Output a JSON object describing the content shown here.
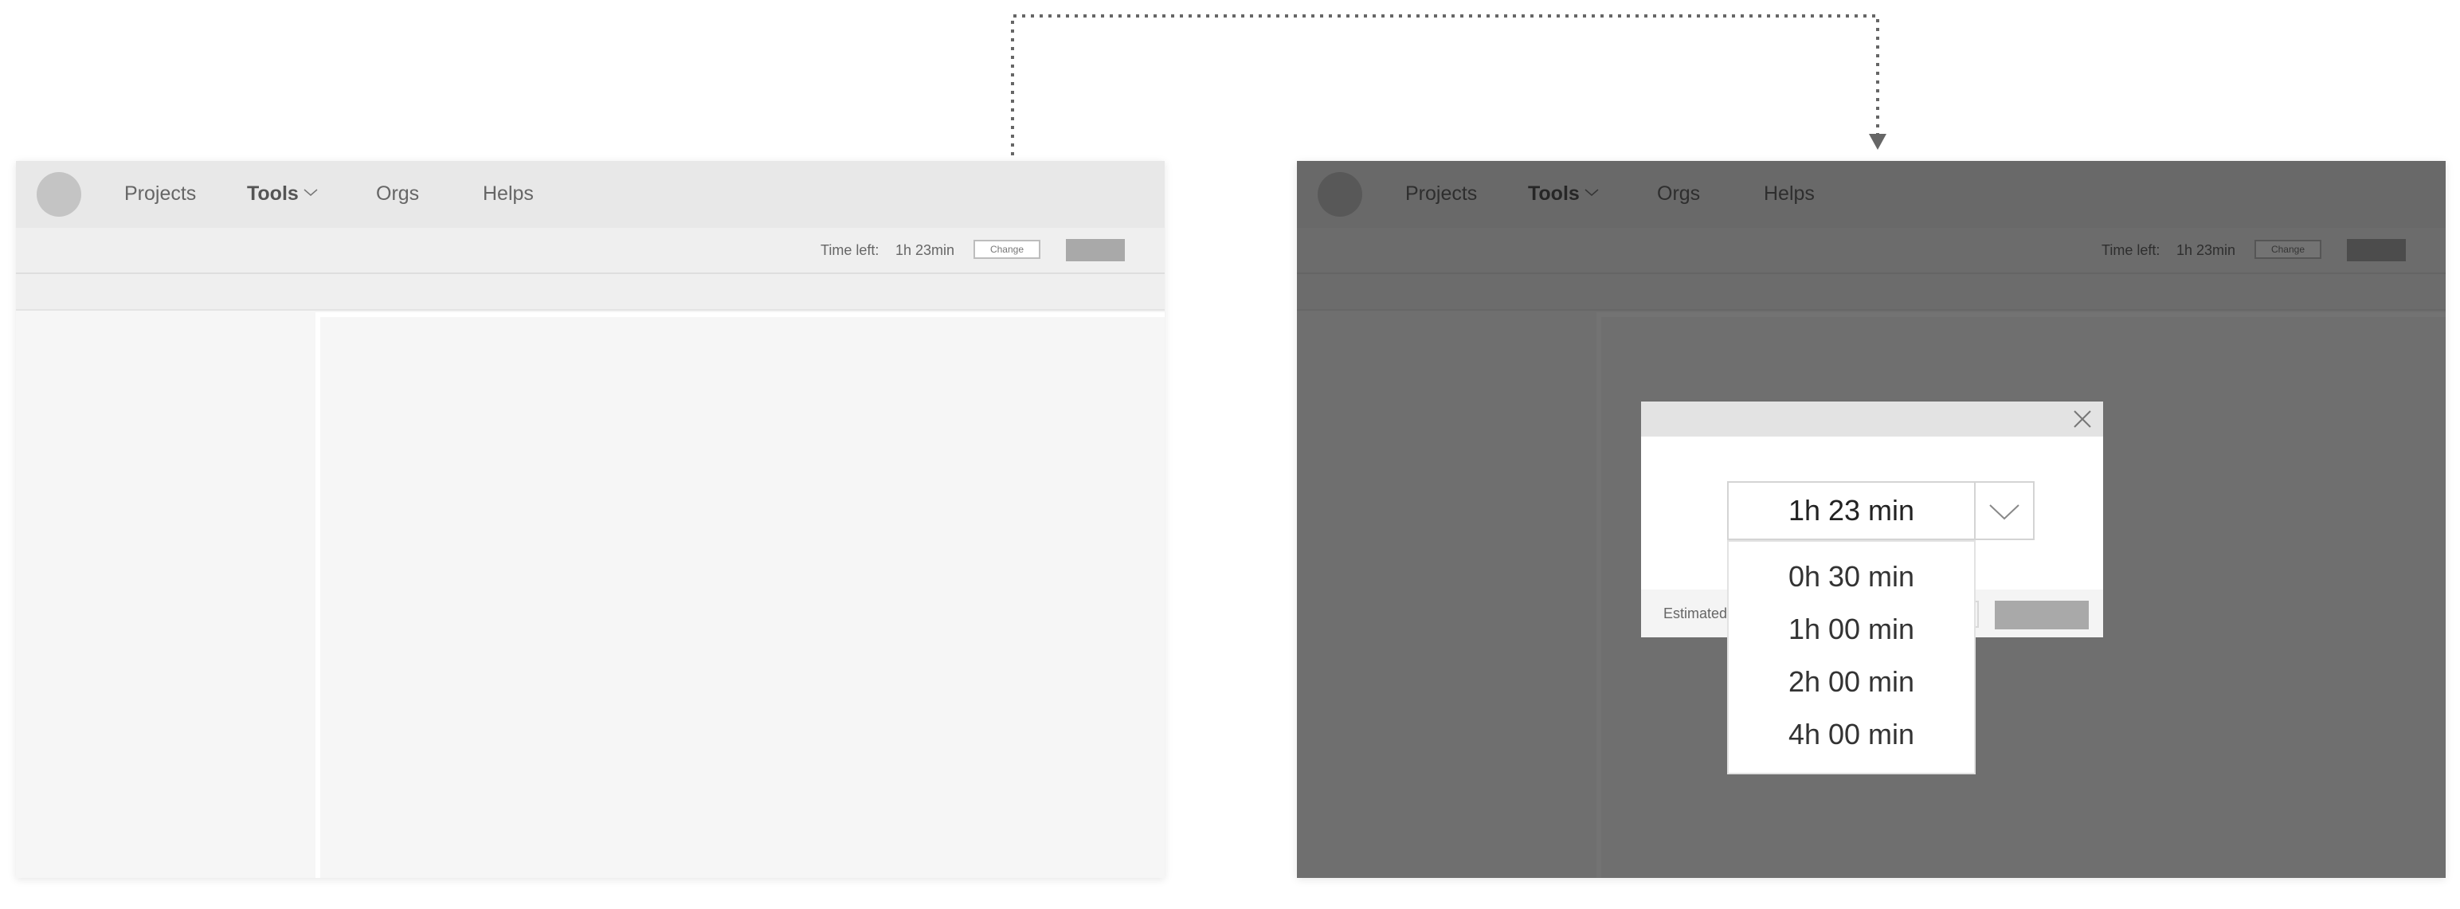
{
  "colors": {
    "navbar_bg": "#e8e8e8",
    "page_bg": "#f6f6f6",
    "avatar": "#c4c4c4",
    "primary_button": "#a9a9a9",
    "overlay": "rgba(0,0,0,0.55)",
    "connector": "#666666"
  },
  "nav": {
    "projects": "Projects",
    "tools": "Tools",
    "orgs": "Orgs",
    "helps": "Helps"
  },
  "toolbar": {
    "time_left_label": "Time left:",
    "time_left_value": "1h 23min",
    "change_button": "Change"
  },
  "modal": {
    "selected_time": "1h 23 min",
    "footer_label": "Estimated",
    "options": [
      "0h 30 min",
      "1h 00 min",
      "2h 00 min",
      "4h 00 min"
    ]
  },
  "icons": {
    "dropdown": "chevron-down-icon",
    "close": "close-icon",
    "arrow": "arrow-down-icon"
  }
}
